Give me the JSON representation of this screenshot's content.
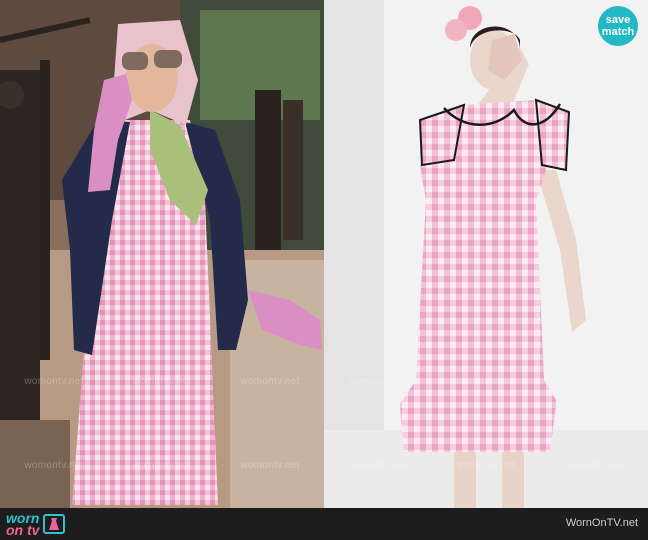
{
  "badge": {
    "line1": "save",
    "line2": "match",
    "color": "#22b8c6"
  },
  "watermark": "womontv.net",
  "footer": {
    "logo_line1": "worn",
    "logo_line2": "on tv",
    "site": "WornOnTV.net"
  },
  "colors": {
    "gingham_pink": "#f4b9d3",
    "glove_pink": "#d98fc4",
    "cardigan_navy": "#232a4a",
    "footer_bg": "#1d1d1d",
    "wall_white": "#f2f2f2"
  }
}
